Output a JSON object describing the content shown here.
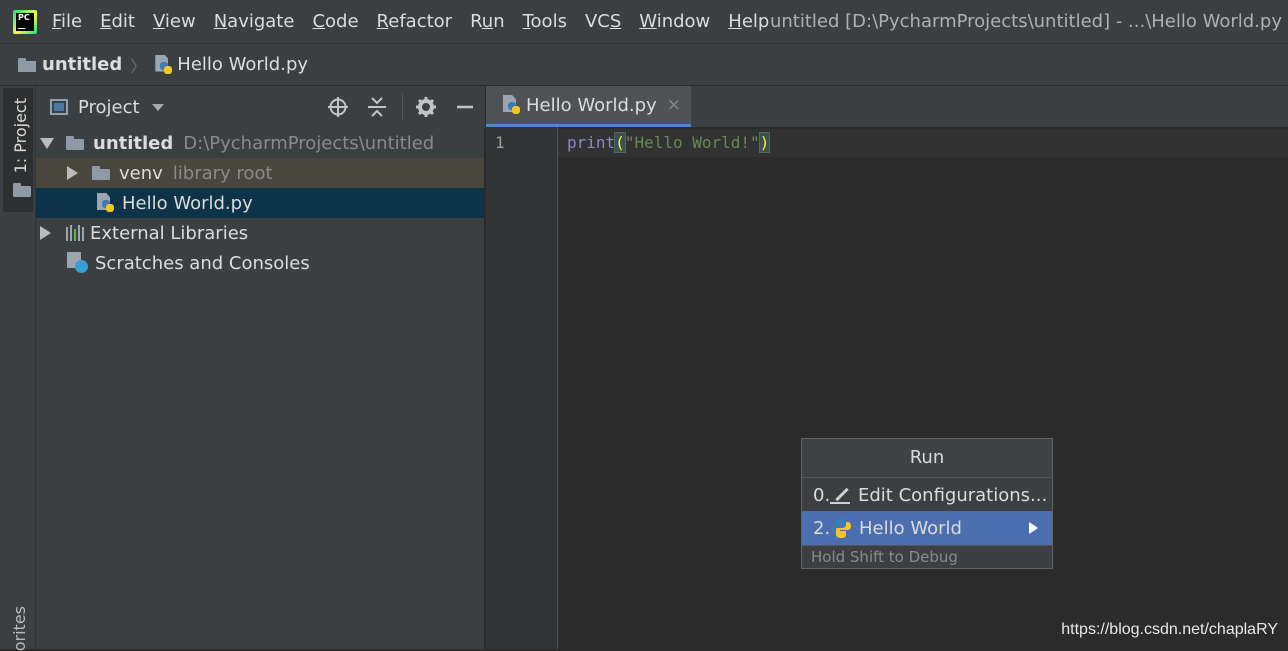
{
  "menubar": {
    "items": [
      {
        "pre": "",
        "ul": "F",
        "post": "ile"
      },
      {
        "pre": "",
        "ul": "E",
        "post": "dit"
      },
      {
        "pre": "",
        "ul": "V",
        "post": "iew"
      },
      {
        "pre": "",
        "ul": "N",
        "post": "avigate"
      },
      {
        "pre": "",
        "ul": "C",
        "post": "ode"
      },
      {
        "pre": "",
        "ul": "R",
        "post": "efactor"
      },
      {
        "pre": "R",
        "ul": "u",
        "post": "n"
      },
      {
        "pre": "",
        "ul": "T",
        "post": "ools"
      },
      {
        "pre": "VC",
        "ul": "S",
        "post": ""
      },
      {
        "pre": "",
        "ul": "W",
        "post": "indow"
      },
      {
        "pre": "",
        "ul": "H",
        "post": "elp"
      }
    ],
    "window_title": "untitled [D:\\PycharmProjects\\untitled] - ...\\Hello World.py",
    "logo_text": "PC"
  },
  "breadcrumb": {
    "root": "untitled",
    "separator": "〉",
    "file": "Hello World.py"
  },
  "tool_strip": {
    "project_label": "1: Project",
    "favorites_label": "orites"
  },
  "project_panel": {
    "title": "Project",
    "tree": {
      "root_name": "untitled",
      "root_path": "D:\\PycharmProjects\\untitled",
      "venv_name": "venv",
      "venv_hint": "library root",
      "file_name": "Hello World.py",
      "ext_libs": "External Libraries",
      "scratches": "Scratches and Consoles"
    }
  },
  "editor": {
    "tab_label": "Hello World.py",
    "tab_close": "×",
    "line_number": "1",
    "code": {
      "func": "print",
      "open": "(",
      "string": "\"Hello World!\"",
      "close": ")"
    }
  },
  "run_popup": {
    "title": "Run",
    "items": [
      {
        "num": "0.",
        "label": "Edit Configurations..."
      },
      {
        "num": "2.",
        "label": "Hello World"
      }
    ],
    "hint": "Hold Shift to Debug"
  },
  "watermark": "https://blog.csdn.net/chaplaRY",
  "colors": {
    "selection": "#0d3349",
    "venv_highlight": "#49473d",
    "popup_selected": "#4b6eaf",
    "string": "#6a8759",
    "builtin": "#8888c6"
  }
}
